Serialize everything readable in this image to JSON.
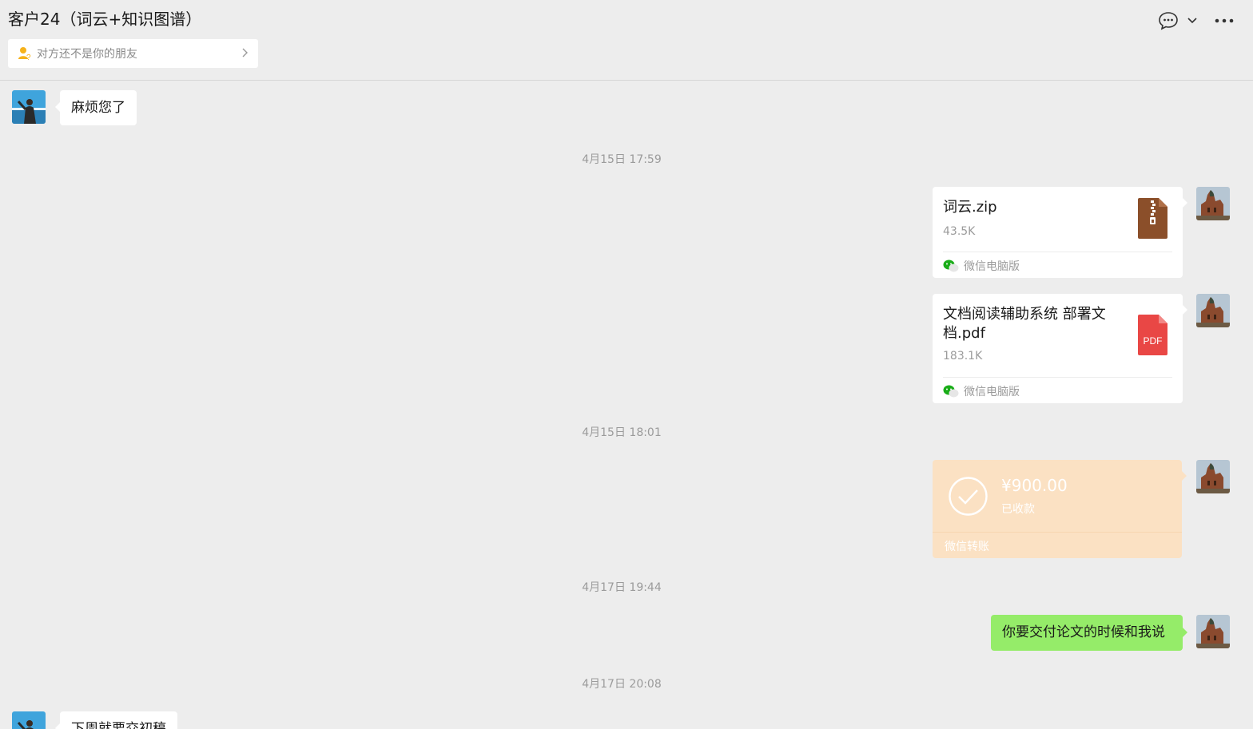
{
  "header": {
    "title": "客户24（词云+知识图谱）",
    "friend_notice": "对方还不是你的朋友",
    "icons": [
      "chat-bubble-icon",
      "chevron-down-icon",
      "more-icon"
    ]
  },
  "messages": [
    {
      "type": "text",
      "side": "left",
      "text": "麻烦您了"
    },
    {
      "type": "timestamp",
      "text": "4月15日 17:59"
    },
    {
      "type": "file",
      "side": "right",
      "name": "词云.zip",
      "size": "43.5K",
      "source": "微信电脑版",
      "icon": "zip-file-icon"
    },
    {
      "type": "file",
      "side": "right",
      "name": "文档阅读辅助系统 部署文档.pdf",
      "size": "183.1K",
      "source": "微信电脑版",
      "icon": "pdf-file-icon",
      "icon_label": "PDF"
    },
    {
      "type": "timestamp",
      "text": "4月15日 18:01"
    },
    {
      "type": "transfer",
      "side": "right",
      "amount": "¥900.00",
      "status": "已收款",
      "label": "微信转账"
    },
    {
      "type": "timestamp",
      "text": "4月17日 19:44"
    },
    {
      "type": "text",
      "side": "right",
      "text": "你要交付论文的时候和我说"
    },
    {
      "type": "timestamp",
      "text": "4月17日 20:08"
    },
    {
      "type": "text",
      "side": "left",
      "text": "下周就要交初稿"
    }
  ],
  "colors": {
    "background": "#ededed",
    "sent_bubble": "#95ec69",
    "transfer_bubble": "#fbe1c3",
    "pdf_red": "#e94745",
    "zip_brown": "#8b4f2a"
  }
}
